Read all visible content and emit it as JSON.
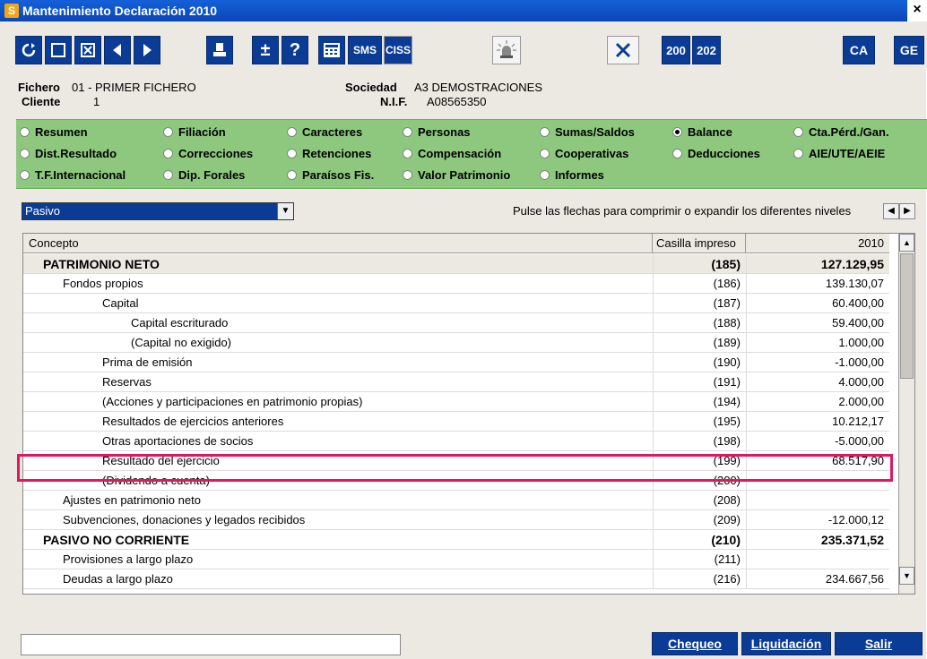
{
  "window": {
    "title": "Mantenimiento Declaración 2010",
    "app_icon": "S",
    "close": "×"
  },
  "toolbar": {
    "sms": "SMS",
    "ciss": "CISS",
    "b200": "200",
    "b202": "202",
    "ca": "CA",
    "ge": "GE",
    "plusminus": "±",
    "help": "?"
  },
  "info": {
    "fichero_label": "Fichero",
    "fichero_value": "01 - PRIMER FICHERO",
    "cliente_label": "Cliente",
    "cliente_value": "1",
    "sociedad_label": "Sociedad",
    "sociedad_value": "A3 DEMOSTRACIONES",
    "nif_label": "N.I.F.",
    "nif_value": "A08565350"
  },
  "radios": [
    {
      "label": "Resumen",
      "checked": false
    },
    {
      "label": "Filiación",
      "checked": false
    },
    {
      "label": "Caracteres",
      "checked": false
    },
    {
      "label": "Personas",
      "checked": false
    },
    {
      "label": "Sumas/Saldos",
      "checked": false
    },
    {
      "label": "Balance",
      "checked": true
    },
    {
      "label": "Cta.Pérd./Gan.",
      "checked": false
    },
    {
      "label": "Dist.Resultado",
      "checked": false
    },
    {
      "label": "Correcciones",
      "checked": false
    },
    {
      "label": "Retenciones",
      "checked": false
    },
    {
      "label": "Compensación",
      "checked": false
    },
    {
      "label": "Cooperativas",
      "checked": false
    },
    {
      "label": "Deducciones",
      "checked": false
    },
    {
      "label": "AIE/UTE/AEIE",
      "checked": false
    },
    {
      "label": "T.F.Internacional",
      "checked": false
    },
    {
      "label": "Dip. Forales",
      "checked": false
    },
    {
      "label": "Paraísos Fis.",
      "checked": false
    },
    {
      "label": "Valor Patrimonio",
      "checked": false
    },
    {
      "label": "Informes",
      "checked": false
    }
  ],
  "selector": {
    "value": "Pasivo"
  },
  "hint": "Pulse las flechas para comprimir o expandir los diferentes niveles",
  "table": {
    "headers": {
      "concepto": "Concepto",
      "casilla": "Casilla impreso",
      "year": "2010"
    },
    "rows": [
      {
        "concepto": "PATRIMONIO NETO",
        "casilla": "(185)",
        "valor": "127.129,95"
      },
      {
        "concepto": "Fondos propios",
        "casilla": "(186)",
        "valor": "139.130,07"
      },
      {
        "concepto": "Capital",
        "casilla": "(187)",
        "valor": "60.400,00"
      },
      {
        "concepto": "Capital escriturado",
        "casilla": "(188)",
        "valor": "59.400,00"
      },
      {
        "concepto": "(Capital no exigido)",
        "casilla": "(189)",
        "valor": "1.000,00"
      },
      {
        "concepto": "Prima de emisión",
        "casilla": "(190)",
        "valor": "-1.000,00"
      },
      {
        "concepto": "Reservas",
        "casilla": "(191)",
        "valor": "4.000,00"
      },
      {
        "concepto": "(Acciones y participaciones en patrimonio propias)",
        "casilla": "(194)",
        "valor": "2.000,00"
      },
      {
        "concepto": "Resultados de ejercicios anteriores",
        "casilla": "(195)",
        "valor": "10.212,17"
      },
      {
        "concepto": "Otras aportaciones de socios",
        "casilla": "(198)",
        "valor": "-5.000,00"
      },
      {
        "concepto": "Resultado del ejercicio",
        "casilla": "(199)",
        "valor": "68.517,90"
      },
      {
        "concepto": "(Dividendo a cuenta)",
        "casilla": "(200)",
        "valor": ""
      },
      {
        "concepto": "Ajustes en patrimonio neto",
        "casilla": "(208)",
        "valor": ""
      },
      {
        "concepto": "Subvenciones, donaciones y legados recibidos",
        "casilla": "(209)",
        "valor": "-12.000,12"
      },
      {
        "concepto": "PASIVO NO CORRIENTE",
        "casilla": "(210)",
        "valor": "235.371,52"
      },
      {
        "concepto": "Provisiones a largo plazo",
        "casilla": "(211)",
        "valor": ""
      },
      {
        "concepto": "Deudas a largo plazo",
        "casilla": "(216)",
        "valor": "234.667,56"
      }
    ]
  },
  "buttons": {
    "chequeo": "Chequeo",
    "liquidacion": "Liquidación",
    "salir": "Salir"
  },
  "colors": {
    "accent": "#0b3c95",
    "green_panel": "#8dc87e",
    "highlight": "#e0185f"
  }
}
